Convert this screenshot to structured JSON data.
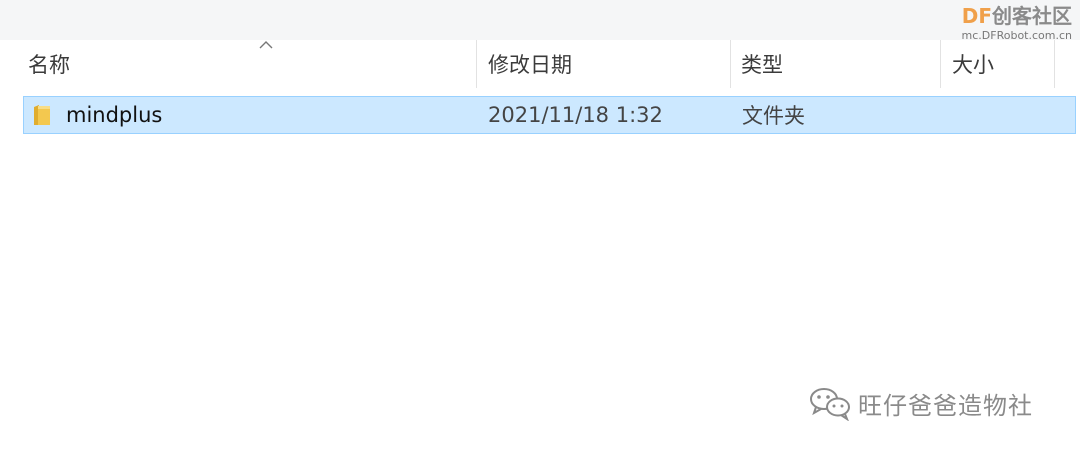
{
  "header": {
    "columns": [
      {
        "label": "名称"
      },
      {
        "label": "修改日期"
      },
      {
        "label": "类型"
      },
      {
        "label": "大小"
      }
    ]
  },
  "files": [
    {
      "name": "mindplus",
      "modified": "2021/11/18 1:32",
      "type": "文件夹",
      "size": ""
    }
  ],
  "watermark_top": {
    "brand_df": "DF",
    "brand_cn": "创客社区",
    "url": "mc.DFRobot.com.cn"
  },
  "watermark_bottom": {
    "label": "旺仔爸爸造物社",
    "icon": "wechat-icon"
  },
  "colors": {
    "selection_bg": "#cce8ff",
    "selection_border": "#99d1ff",
    "folder": "#f3c84f",
    "brand_accent": "#f0a04a"
  }
}
